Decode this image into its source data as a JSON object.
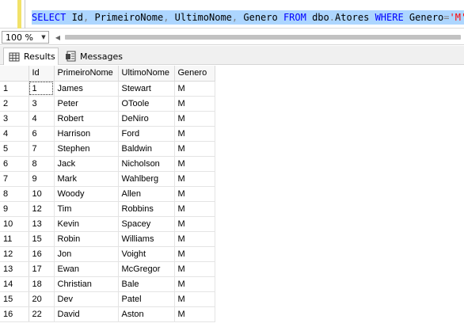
{
  "editor": {
    "tokens": [
      {
        "t": "SELECT",
        "c": "kw"
      },
      {
        "t": " Id",
        "c": "id"
      },
      {
        "t": ",",
        "c": "sym"
      },
      {
        "t": " PrimeiroNome",
        "c": "id"
      },
      {
        "t": ",",
        "c": "sym"
      },
      {
        "t": " UltimoNome",
        "c": "id"
      },
      {
        "t": ",",
        "c": "sym"
      },
      {
        "t": " Genero ",
        "c": "id"
      },
      {
        "t": "FROM",
        "c": "kw"
      },
      {
        "t": " dbo",
        "c": "id"
      },
      {
        "t": ".",
        "c": "sym"
      },
      {
        "t": "Atores ",
        "c": "id"
      },
      {
        "t": "WHERE",
        "c": "kw"
      },
      {
        "t": " Genero",
        "c": "id"
      },
      {
        "t": "=",
        "c": "sym"
      },
      {
        "t": "'M'",
        "c": "str"
      },
      {
        "t": ";",
        "c": "sym"
      }
    ]
  },
  "zoom": {
    "value": "100 %"
  },
  "tabs": [
    {
      "label": "Results",
      "icon": "grid-icon",
      "active": true
    },
    {
      "label": "Messages",
      "icon": "messages-icon",
      "active": false
    }
  ],
  "grid": {
    "columns": [
      "Id",
      "PrimeiroNome",
      "UltimoNome",
      "Genero"
    ],
    "rows": [
      [
        "1",
        "1",
        "James",
        "Stewart",
        "M"
      ],
      [
        "2",
        "3",
        "Peter",
        "OToole",
        "M"
      ],
      [
        "3",
        "4",
        "Robert",
        "DeNiro",
        "M"
      ],
      [
        "4",
        "6",
        "Harrison",
        "Ford",
        "M"
      ],
      [
        "5",
        "7",
        "Stephen",
        "Baldwin",
        "M"
      ],
      [
        "6",
        "8",
        "Jack",
        "Nicholson",
        "M"
      ],
      [
        "7",
        "9",
        "Mark",
        "Wahlberg",
        "M"
      ],
      [
        "8",
        "10",
        "Woody",
        "Allen",
        "M"
      ],
      [
        "9",
        "12",
        "Tim",
        "Robbins",
        "M"
      ],
      [
        "10",
        "13",
        "Kevin",
        "Spacey",
        "M"
      ],
      [
        "11",
        "15",
        "Robin",
        "Williams",
        "M"
      ],
      [
        "12",
        "16",
        "Jon",
        "Voight",
        "M"
      ],
      [
        "13",
        "17",
        "Ewan",
        "McGregor",
        "M"
      ],
      [
        "14",
        "18",
        "Christian",
        "Bale",
        "M"
      ],
      [
        "15",
        "20",
        "Dev",
        "Patel",
        "M"
      ],
      [
        "16",
        "22",
        "David",
        "Aston",
        "M"
      ]
    ]
  }
}
